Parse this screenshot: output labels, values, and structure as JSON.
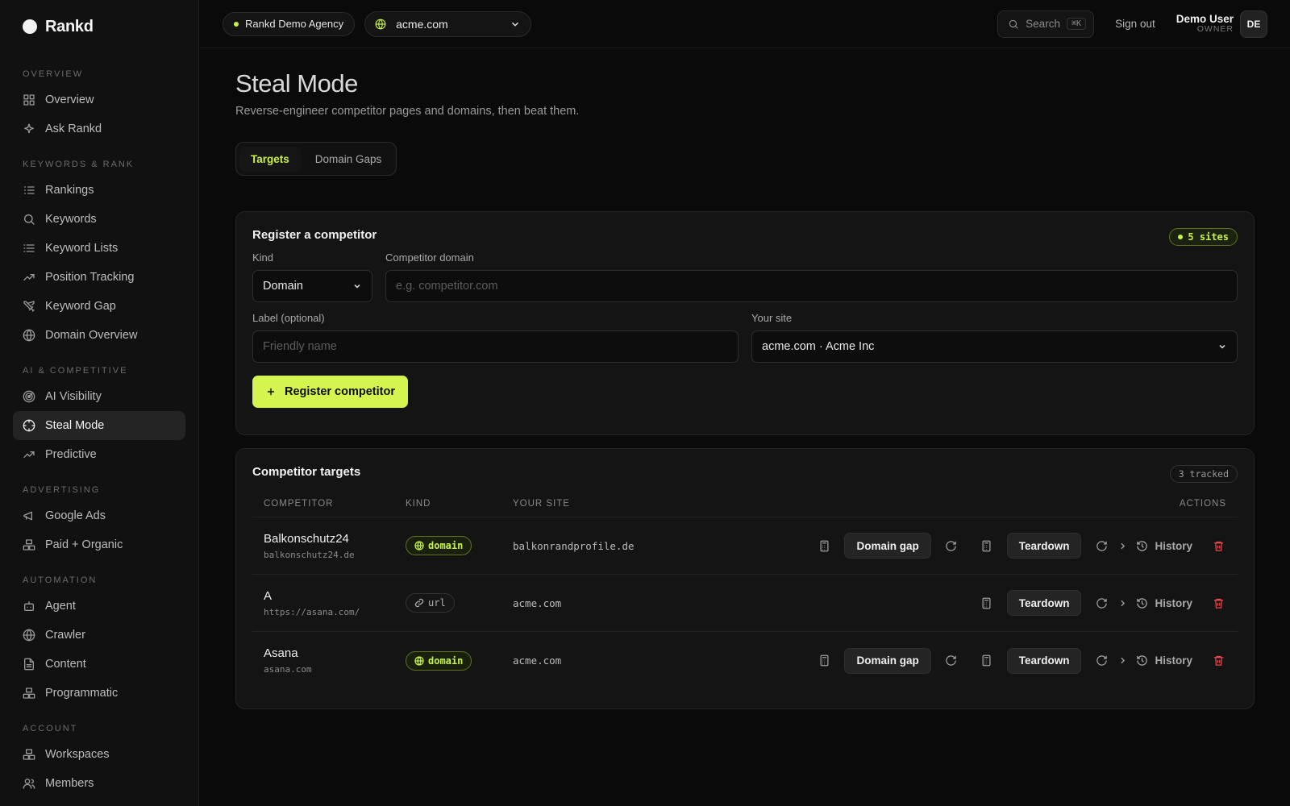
{
  "app": {
    "name": "Rankd"
  },
  "sidebar": {
    "sections": [
      {
        "title": "OVERVIEW",
        "items": [
          {
            "label": "Overview",
            "icon": "grid-icon"
          },
          {
            "label": "Ask Rankd",
            "icon": "sparkle-icon"
          }
        ]
      },
      {
        "title": "KEYWORDS & RANK",
        "items": [
          {
            "label": "Rankings",
            "icon": "list-ordered-icon"
          },
          {
            "label": "Keywords",
            "icon": "search-icon"
          },
          {
            "label": "Keyword Lists",
            "icon": "list-icon"
          },
          {
            "label": "Position Tracking",
            "icon": "trending-up-icon"
          },
          {
            "label": "Keyword Gap",
            "icon": "swords-icon"
          },
          {
            "label": "Domain Overview",
            "icon": "globe-icon"
          }
        ]
      },
      {
        "title": "AI & COMPETITIVE",
        "items": [
          {
            "label": "AI Visibility",
            "icon": "radar-icon"
          },
          {
            "label": "Steal Mode",
            "icon": "crosshair-icon",
            "active": true
          },
          {
            "label": "Predictive",
            "icon": "trending-up-icon"
          }
        ]
      },
      {
        "title": "ADVERTISING",
        "items": [
          {
            "label": "Google Ads",
            "icon": "megaphone-icon"
          },
          {
            "label": "Paid + Organic",
            "icon": "boxes-icon"
          }
        ]
      },
      {
        "title": "AUTOMATION",
        "items": [
          {
            "label": "Agent",
            "icon": "bot-icon"
          },
          {
            "label": "Crawler",
            "icon": "globe-icon"
          },
          {
            "label": "Content",
            "icon": "file-text-icon"
          },
          {
            "label": "Programmatic",
            "icon": "boxes-icon"
          }
        ]
      },
      {
        "title": "ACCOUNT",
        "items": [
          {
            "label": "Workspaces",
            "icon": "boxes-icon"
          },
          {
            "label": "Members",
            "icon": "users-icon"
          }
        ]
      }
    ]
  },
  "topbar": {
    "agency": "Rankd Demo Agency",
    "site": "acme.com",
    "search_label": "Search",
    "search_kbd": "⌘K",
    "signout": "Sign out",
    "user_name": "Demo User",
    "user_role": "OWNER",
    "avatar_initials": "DE"
  },
  "page": {
    "title": "Steal Mode",
    "subtitle": "Reverse-engineer competitor pages and domains, then beat them.",
    "tabs": [
      {
        "label": "Targets",
        "active": true
      },
      {
        "label": "Domain Gaps"
      }
    ]
  },
  "register": {
    "title": "Register a competitor",
    "sites_badge": "5 sites",
    "kind_label": "Kind",
    "kind_value": "Domain",
    "domain_label": "Competitor domain",
    "domain_placeholder": "e.g. competitor.com",
    "label_label": "Label (optional)",
    "label_placeholder": "Friendly name",
    "site_label": "Your site",
    "site_value": "acme.com · Acme Inc",
    "submit": "Register competitor"
  },
  "targets": {
    "title": "Competitor targets",
    "tracked_badge": "3 tracked",
    "columns": {
      "competitor": "COMPETITOR",
      "kind": "KIND",
      "site": "YOUR SITE",
      "actions": "ACTIONS"
    },
    "action_labels": {
      "domain_gap": "Domain gap",
      "teardown": "Teardown",
      "history": "History"
    },
    "rows": [
      {
        "name": "Balkonschutz24",
        "sub": "balkonschutz24.de",
        "kind": "domain",
        "site": "balkonrandprofile.de",
        "has_gap": true
      },
      {
        "name": "A",
        "sub": "https://asana.com/",
        "kind": "url",
        "site": "acme.com",
        "has_gap": false
      },
      {
        "name": "Asana",
        "sub": "asana.com",
        "kind": "domain",
        "site": "acme.com",
        "has_gap": true
      }
    ]
  },
  "colors": {
    "accent": "#c6f24a",
    "danger": "#e5484d",
    "background": "#0a0a0a"
  }
}
